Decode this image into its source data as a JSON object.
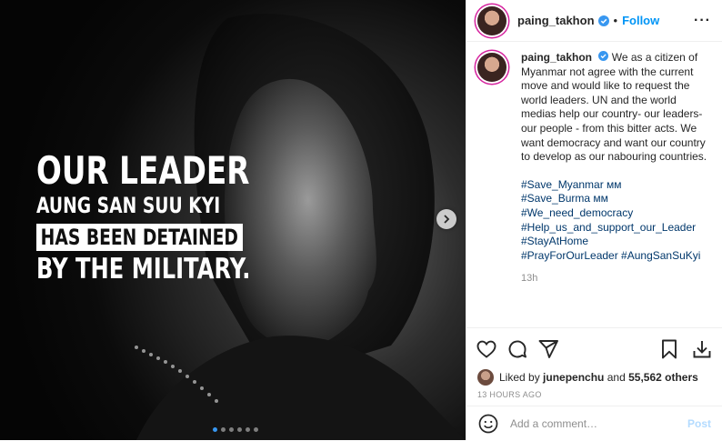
{
  "media": {
    "overlay": {
      "line1": "OUR LEADER",
      "line2": "AUNG SAN SUU KYI",
      "line3": "HAS BEEN DETAINED",
      "line4": "BY THE MILITARY."
    },
    "carousel": {
      "count": 6,
      "active_index": 0
    }
  },
  "header": {
    "username": "paing_takhon",
    "separator": "•",
    "follow_label": "Follow",
    "more_label": "···"
  },
  "caption": {
    "username": "paing_takhon",
    "text": "We as a citizen of Myanmar not agree with the current move and would like to request the world leaders. UN and the world medias help our country- our leaders- our people - from this bitter acts. We want democracy and want our country to develop as our nabouring countries.",
    "hashtags": [
      "#Save_Myanmar ᴍᴍ",
      "#Save_Burma ᴍᴍ",
      "#We_need_democracy",
      "#Help_us_and_support_our_Leader",
      "#StayAtHome",
      "#PrayForOurLeader #AungSanSuKyi"
    ],
    "time": "13h"
  },
  "likes": {
    "prefix": "Liked by",
    "user": "junepenchu",
    "and": "and",
    "count": "55,562 others"
  },
  "posted_ago": "13 HOURS AGO",
  "comment_box": {
    "placeholder": "Add a comment…",
    "post_label": "Post"
  },
  "colors": {
    "link": "#00376b",
    "follow": "#0095f6",
    "verified": "#3897f0"
  }
}
